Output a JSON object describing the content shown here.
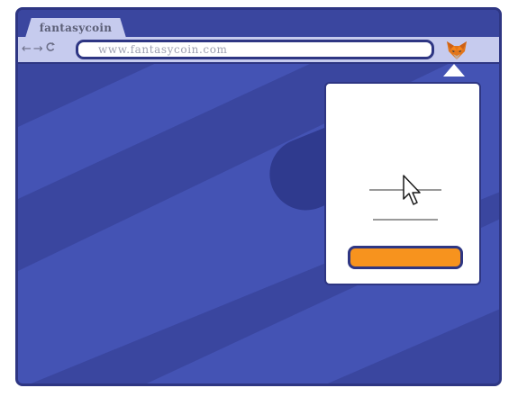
{
  "browser": {
    "tab": {
      "title": "fantasycoin"
    },
    "toolbar": {
      "back_glyph": "←",
      "forward_glyph": "→",
      "reload_glyph": "C",
      "url": "www.fantasycoin.com"
    },
    "extension": {
      "icon": "fox-extension-icon"
    }
  },
  "popup": {
    "text_lines": 2,
    "button_label": ""
  },
  "colors": {
    "background": "#3a469f",
    "stripe": "#4453b4",
    "outline": "#2e3683",
    "chrome": "#c6cbee",
    "accent_button": "#f7931e"
  }
}
